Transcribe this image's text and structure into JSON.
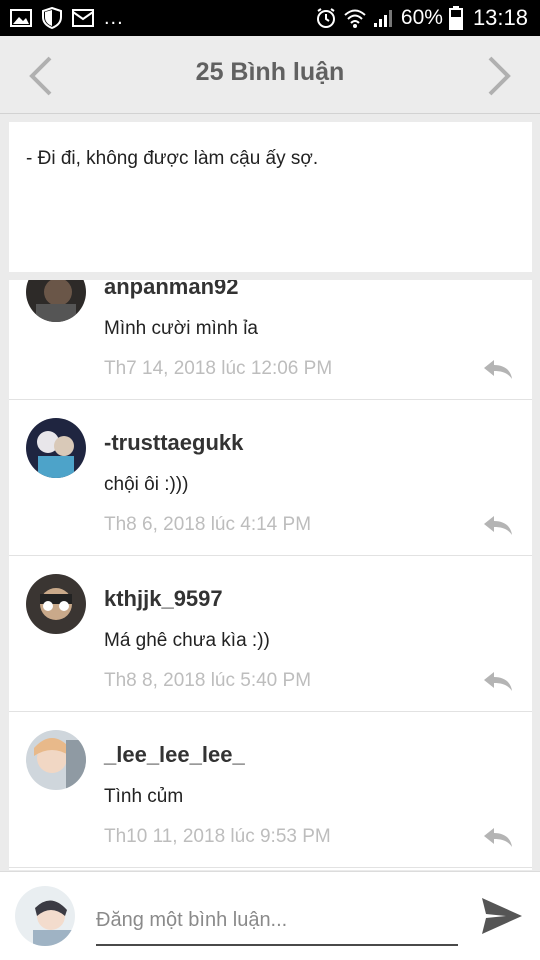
{
  "status_bar": {
    "battery_percent": "60%",
    "time": "13:18",
    "more_indicator": "..."
  },
  "header": {
    "title": "25 Bình luận"
  },
  "quote": {
    "text": "- Đi đi, không được làm cậu ấy sợ."
  },
  "comments": [
    {
      "username": "anpanman92",
      "text": "Mình cười mình ỉa",
      "time": "Th7 14, 2018 lúc 12:06 PM"
    },
    {
      "username": "-trusttaegukk",
      "text": "chội ôi :)))",
      "time": "Th8 6, 2018 lúc 4:14 PM"
    },
    {
      "username": "kthjjk_9597",
      "text": "Má ghê chưa kìa :))",
      "time": "Th8 8, 2018 lúc 5:40 PM"
    },
    {
      "username": "_lee_lee_lee_",
      "text": "Tình củm",
      "time": "Th10 11, 2018 lúc 9:53 PM"
    }
  ],
  "compose": {
    "placeholder": "Đăng một bình luận..."
  },
  "colors": {
    "header_bg": "#ececec",
    "page_bg": "#ebebeb",
    "title_text": "#616161",
    "timestamp": "#bdbdbd",
    "icon_gray": "#b4b4b4"
  },
  "icons": [
    "image-icon",
    "shield-icon",
    "mail-icon",
    "alarm-icon",
    "wifi-icon",
    "signal-icon",
    "battery-icon",
    "chevron-left-icon",
    "chevron-right-icon",
    "reply-icon",
    "send-icon"
  ]
}
